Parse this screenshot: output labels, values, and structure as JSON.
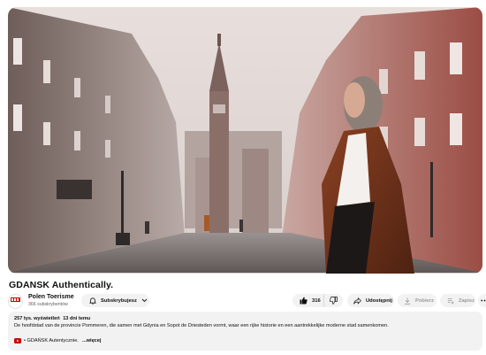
{
  "video": {
    "title": "GDANSK Authentically."
  },
  "channel": {
    "name": "Polen Toerisme",
    "subscribers": "366 subskrybentów",
    "avatar_icon": "polen-logo-icon",
    "subscribe_label": "Subskrybujesz"
  },
  "actions": {
    "likes": "316",
    "share_label": "Udostępnij",
    "download_label": "Pobierz",
    "save_label": "Zapisz"
  },
  "description": {
    "views": "257 tys. wyświetleń",
    "date": "13 dni temu",
    "text": "De hoofdstad van de provincie Pommeren, die samen met Gdynia en Sopot de Driesteden vormt, waar een rijke historie en een aantrekkelijke moderne stad samenkomen.",
    "chapter": "• GDAŃSK Autentycznie.",
    "more": "...więcej"
  },
  "colors": {
    "accent_red": "#cc0000",
    "pill_bg": "#f2f2f2",
    "muted_text": "#606060"
  }
}
